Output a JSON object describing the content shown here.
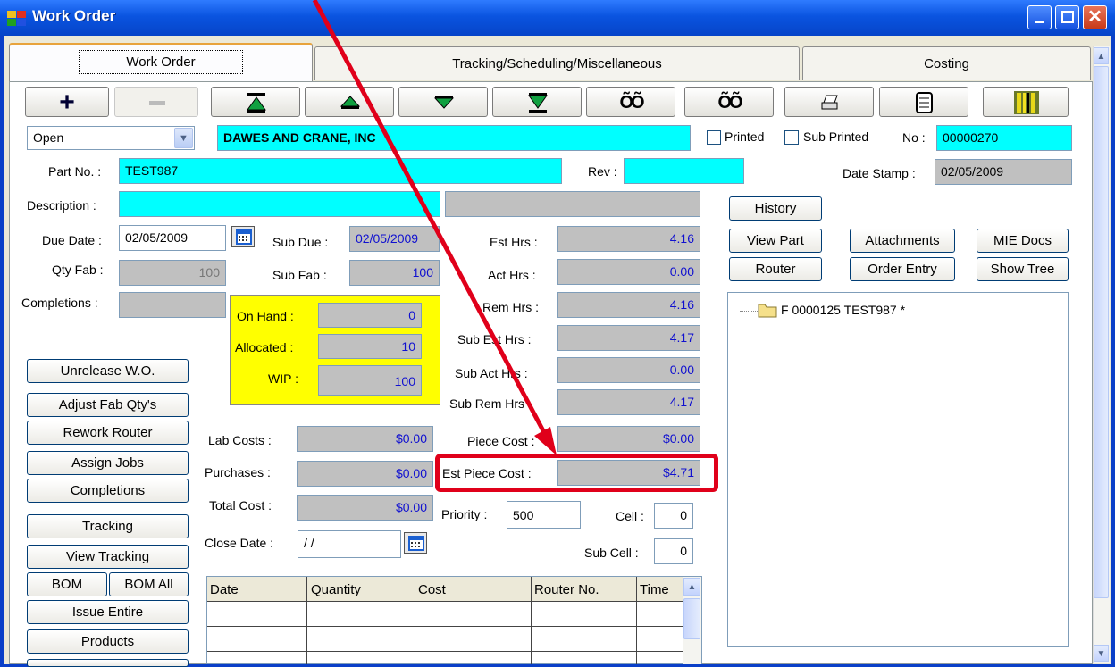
{
  "window": {
    "title": "Work Order"
  },
  "tabs": [
    {
      "label": "Work Order"
    },
    {
      "label": "Tracking/Scheduling/Miscellaneous"
    },
    {
      "label": "Costing"
    }
  ],
  "toolbar": {
    "buttons": [
      {
        "name": "add-button",
        "icon": "plus-icon"
      },
      {
        "name": "delete-button",
        "icon": "minus-icon"
      },
      {
        "name": "first-record-button",
        "icon": "first-icon"
      },
      {
        "name": "previous-record-button",
        "icon": "up-triangle-icon"
      },
      {
        "name": "next-record-button",
        "icon": "down-triangle-icon"
      },
      {
        "name": "last-record-button",
        "icon": "last-icon"
      },
      {
        "name": "find-button",
        "icon": "binoculars-icon"
      },
      {
        "name": "find-next-button",
        "icon": "binoculars-icon"
      },
      {
        "name": "print-button",
        "icon": "printer-icon"
      },
      {
        "name": "report-button",
        "icon": "scroll-icon"
      },
      {
        "name": "barcode-button",
        "icon": "barcode-icon"
      }
    ]
  },
  "status_select": {
    "value": "Open"
  },
  "customer": {
    "value": "DAWES AND CRANE, INC"
  },
  "printed": {
    "label": "Printed",
    "checked": false
  },
  "sub_printed": {
    "label": "Sub Printed",
    "checked": false
  },
  "number": {
    "label": "No :",
    "value": "00000270"
  },
  "part_no": {
    "label": "Part No. :",
    "value": "TEST987"
  },
  "rev": {
    "label": "Rev :",
    "value": ""
  },
  "date_stamp": {
    "label": "Date Stamp :",
    "value": "02/05/2009"
  },
  "description": {
    "label": "Description :",
    "value": "",
    "value2": ""
  },
  "due_date": {
    "label": "Due Date :",
    "value": "02/05/2009"
  },
  "sub_due": {
    "label": "Sub Due :",
    "value": "02/05/2009"
  },
  "qty_fab": {
    "label": "Qty Fab :",
    "value": "100"
  },
  "sub_fab": {
    "label": "Sub Fab :",
    "value": "100"
  },
  "completions": {
    "label": "Completions :",
    "value": ""
  },
  "stock": {
    "on_hand": {
      "label": "On Hand :",
      "value": "0"
    },
    "allocated": {
      "label": "Allocated :",
      "value": "10"
    },
    "wip": {
      "label": "WIP :",
      "value": "100"
    }
  },
  "hours": [
    {
      "label": "Est Hrs :",
      "value": "4.16"
    },
    {
      "label": "Act Hrs :",
      "value": "0.00"
    },
    {
      "label": "Rem Hrs :",
      "value": "4.16"
    },
    {
      "label": "Sub Est Hrs :",
      "value": "4.17"
    },
    {
      "label": "Sub Act Hrs :",
      "value": "0.00"
    },
    {
      "label": "Sub Rem Hrs :",
      "value": "4.17"
    }
  ],
  "costs": {
    "lab": {
      "label": "Lab Costs :",
      "value": "$0.00"
    },
    "purchases": {
      "label": "Purchases :",
      "value": "$0.00"
    },
    "total": {
      "label": "Total Cost :",
      "value": "$0.00"
    },
    "piece": {
      "label": "Piece Cost :",
      "value": "$0.00"
    },
    "est_piece": {
      "label": "Est Piece Cost :",
      "value": "$4.71"
    }
  },
  "priority": {
    "label": "Priority :",
    "value": "500"
  },
  "cell": {
    "label": "Cell :",
    "value": "0"
  },
  "sub_cell": {
    "label": "Sub Cell :",
    "value": "0"
  },
  "close_date": {
    "label": "Close Date :",
    "value": " / /"
  },
  "left_buttons": {
    "unrelease": "Unrelease W.O.",
    "adjust": "Adjust Fab Qty's",
    "rework": "Rework Router",
    "assign": "Assign Jobs",
    "completions": "Completions",
    "tracking": "Tracking",
    "view_tracking": "View Tracking",
    "bom": "BOM",
    "bom_all": "BOM All",
    "issue_entire": "Issue Entire",
    "products": "Products"
  },
  "right_buttons": {
    "history": "History",
    "view_part": "View Part",
    "attachments": "Attachments",
    "mie_docs": "MIE Docs",
    "router": "Router",
    "order_entry": "Order Entry",
    "show_tree": "Show Tree"
  },
  "grid": {
    "columns": [
      "Date",
      "Quantity",
      "Cost",
      "Router No.",
      "Time"
    ]
  },
  "tree": {
    "items": [
      {
        "label": "F 0000125 TEST987  *"
      }
    ]
  },
  "colors": {
    "highlight_box": "#e0001a",
    "annotation_arrow": "#e0001a",
    "cyan_field": "#00ffff",
    "stock_panel": "#ffff00"
  }
}
